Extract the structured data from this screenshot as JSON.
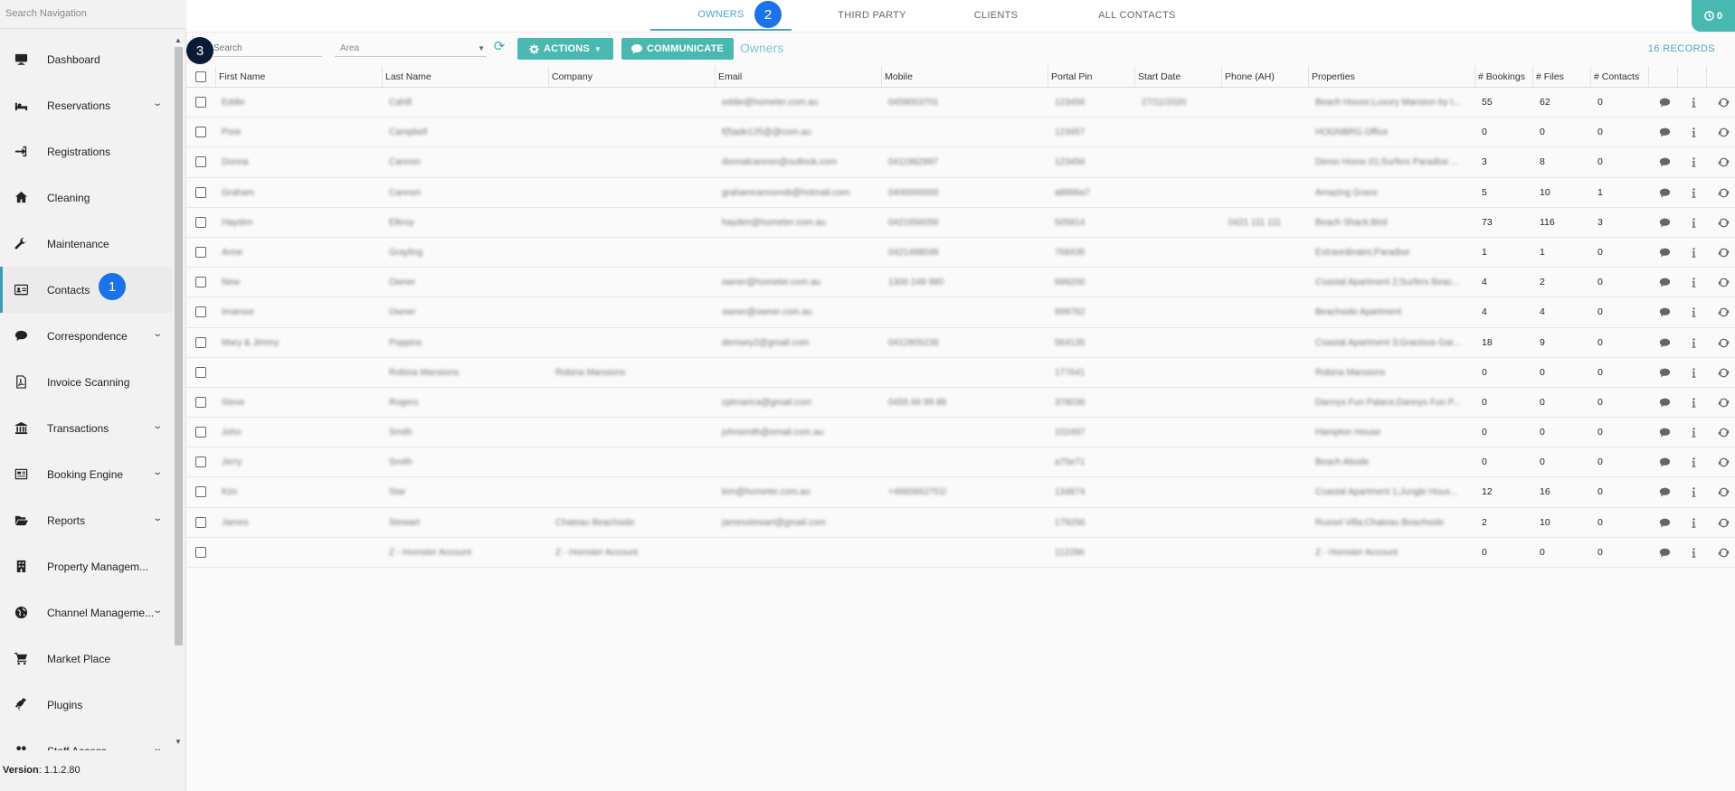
{
  "sidebar": {
    "search_placeholder": "Search Navigation",
    "items": [
      {
        "label": "Dashboard",
        "icon": "monitor-icon",
        "chevron": false
      },
      {
        "label": "Reservations",
        "icon": "bed-icon",
        "chevron": true
      },
      {
        "label": "Registrations",
        "icon": "sign-in-icon",
        "chevron": false
      },
      {
        "label": "Cleaning",
        "icon": "home-icon",
        "chevron": false
      },
      {
        "label": "Maintenance",
        "icon": "wrench-icon",
        "chevron": false
      },
      {
        "label": "Contacts",
        "icon": "address-card-icon",
        "chevron": false,
        "active": true
      },
      {
        "label": "Correspondence",
        "icon": "chat-icon",
        "chevron": true
      },
      {
        "label": "Invoice Scanning",
        "icon": "file-pdf-icon",
        "chevron": false
      },
      {
        "label": "Transactions",
        "icon": "bank-icon",
        "chevron": true
      },
      {
        "label": "Booking Engine",
        "icon": "newspaper-icon",
        "chevron": true
      },
      {
        "label": "Reports",
        "icon": "folder-open-icon",
        "chevron": true
      },
      {
        "label": "Property Managem...",
        "icon": "building-icon",
        "chevron": false
      },
      {
        "label": "Channel Manageme...",
        "icon": "globe-icon",
        "chevron": true
      },
      {
        "label": "Market Place",
        "icon": "cart-icon",
        "chevron": false
      },
      {
        "label": "Plugins",
        "icon": "plug-icon",
        "chevron": false
      },
      {
        "label": "Staff Access",
        "icon": "users-icon",
        "chevron": true
      }
    ],
    "version_label": "Version",
    "version_value": ": 1.1.2.80"
  },
  "badges": {
    "b1": "1",
    "b2": "2",
    "b3": "3"
  },
  "tabs": [
    {
      "label": "OWNERS",
      "active": true
    },
    {
      "label": "THIRD PARTY",
      "active": false
    },
    {
      "label": "CLIENTS",
      "active": false
    },
    {
      "label": "ALL CONTACTS",
      "active": false
    }
  ],
  "top_right_button": {
    "label": "0",
    "icon": "clock-icon"
  },
  "toolbar": {
    "search_placeholder": "Search",
    "area_placeholder": "Area",
    "actions_label": "ACTIONS",
    "communicate_label": "COMMUNICATE",
    "title": "Owners",
    "records": "16 RECORDS"
  },
  "table": {
    "columns": [
      "First Name",
      "Last Name",
      "Company",
      "Email",
      "Mobile",
      "Portal Pin",
      "Start Date",
      "Phone (AH)",
      "Properties",
      "# Bookings",
      "# Files",
      "# Contacts"
    ],
    "rows": [
      {
        "first": "Eddie",
        "last": "Cahill",
        "company": "",
        "email": "eddie@hometer.com.au",
        "mobile": "0459003701",
        "pin": "123456",
        "start": "27/11/2020",
        "phone": "",
        "props": "Beach House;Luxury Mansion by t...",
        "bookings": "55",
        "files": "62",
        "contacts": "0"
      },
      {
        "first": "Pixie",
        "last": "Campbell",
        "company": "",
        "email": "f(f)ade125@@com.au",
        "mobile": "",
        "pin": "123457",
        "start": "",
        "phone": "",
        "props": "HOGNBRG Office",
        "bookings": "0",
        "files": "0",
        "contacts": "0"
      },
      {
        "first": "Donna",
        "last": "Cannon",
        "company": "",
        "email": "donnalcannon@outlook.com",
        "mobile": "0411982897",
        "pin": "123456",
        "start": "",
        "phone": "",
        "props": "Demo Home 01;Surfers Paradise ...",
        "bookings": "3",
        "files": "8",
        "contacts": "0"
      },
      {
        "first": "Graham",
        "last": "Cannon",
        "company": "",
        "email": "grahamcannonsb@hotmail.com",
        "mobile": "0400000000",
        "pin": "a8896a7",
        "start": "",
        "phone": "",
        "props": "Amazing Grace",
        "bookings": "5",
        "files": "10",
        "contacts": "1"
      },
      {
        "first": "Hayden",
        "last": "Elkroy",
        "company": "",
        "email": "hayden@hometer.com.au",
        "mobile": "0421656056",
        "pin": "505814",
        "start": "",
        "phone": "0421 111 111",
        "props": "Beach Shack;Bird",
        "bookings": "73",
        "files": "116",
        "contacts": "3"
      },
      {
        "first": "Anne",
        "last": "Grayling",
        "company": "",
        "email": "",
        "mobile": "0421498048",
        "pin": "768435",
        "start": "",
        "phone": "",
        "props": "Extraordinaire;Paradise",
        "bookings": "1",
        "files": "1",
        "contacts": "0"
      },
      {
        "first": "New",
        "last": "Owner",
        "company": "",
        "email": "owner@hometer.com.au",
        "mobile": "1300 249 980",
        "pin": "699200",
        "start": "",
        "phone": "",
        "props": "Coastal Apartment 2;Surfers Beac...",
        "bookings": "4",
        "files": "2",
        "contacts": "0"
      },
      {
        "first": "Imansor",
        "last": "Owner",
        "company": "",
        "email": "owner@owner.com.au",
        "mobile": "",
        "pin": "999762",
        "start": "",
        "phone": "",
        "props": "Beachside Apartment",
        "bookings": "4",
        "files": "4",
        "contacts": "0"
      },
      {
        "first": "Mary & Jimmy",
        "last": "Poppins",
        "company": "",
        "email": "demsey2@gmail.com",
        "mobile": "0412805239",
        "pin": "564135",
        "start": "",
        "phone": "",
        "props": "Coastal Apartment 3;Gracious Gar...",
        "bookings": "18",
        "files": "9",
        "contacts": "0"
      },
      {
        "first": "",
        "last": "Robina Mansions",
        "company": "Robina Mansions",
        "email": "",
        "mobile": "",
        "pin": "177641",
        "start": "",
        "phone": "",
        "props": "Robina Mansions",
        "bookings": "0",
        "files": "0",
        "contacts": "0"
      },
      {
        "first": "Steve",
        "last": "Rogers",
        "company": "",
        "email": "cptmarica@gmail.com",
        "mobile": "0455 66 99 88",
        "pin": "378036",
        "start": "",
        "phone": "",
        "props": "Dannys Fun Palace;Dannys Fun P...",
        "bookings": "0",
        "files": "0",
        "contacts": "0"
      },
      {
        "first": "John",
        "last": "Smith",
        "company": "",
        "email": "johnsmith@email.com.au",
        "mobile": "",
        "pin": "102497",
        "start": "",
        "phone": "",
        "props": "Hampton House",
        "bookings": "0",
        "files": "0",
        "contacts": "0"
      },
      {
        "first": "Jerry",
        "last": "Smith",
        "company": "",
        "email": "",
        "mobile": "",
        "pin": "a75e71",
        "start": "",
        "phone": "",
        "props": "Beach Abode",
        "bookings": "0",
        "files": "0",
        "contacts": "0"
      },
      {
        "first": "Kim",
        "last": "Star",
        "company": "",
        "email": "kim@hometer.com.au",
        "mobile": "+4660662751l",
        "pin": "134874",
        "start": "",
        "phone": "",
        "props": "Coastal Apartment 1;Jungle Hous...",
        "bookings": "12",
        "files": "16",
        "contacts": "0"
      },
      {
        "first": "James",
        "last": "Stewart",
        "company": "Chateau Beachside",
        "email": "jamesstewart@gmail.com",
        "mobile": "",
        "pin": "179256",
        "start": "",
        "phone": "",
        "props": "Russel Villa;Chateau Beachside",
        "bookings": "2",
        "files": "10",
        "contacts": "0"
      },
      {
        "first": "",
        "last": "Z - Homster Account",
        "company": "Z - Homster Account",
        "email": "",
        "mobile": "",
        "pin": "112286",
        "start": "",
        "phone": "",
        "props": "Z - Homster Account",
        "bookings": "0",
        "files": "0",
        "contacts": "0"
      }
    ]
  },
  "colors": {
    "accent": "#49b8b0",
    "link": "#49a9c4",
    "badge": "#1a73e8",
    "badge_dark": "#0b1a35"
  }
}
